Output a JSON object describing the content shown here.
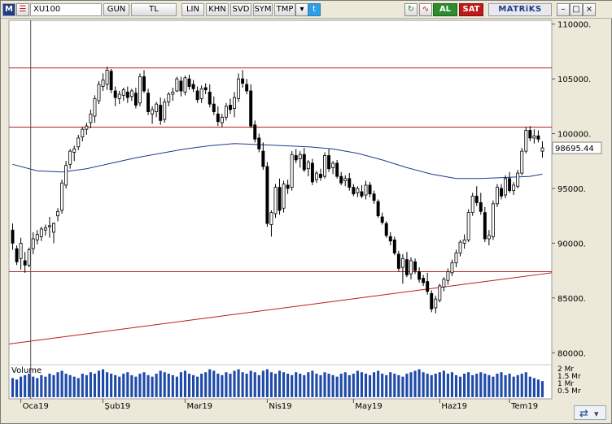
{
  "toolbar": {
    "menu_label": "M",
    "symbol": "XU100",
    "period": "GUN",
    "currency": "TL",
    "scale": "LIN",
    "khn": "KHN",
    "svd": "SVD",
    "sym_btn": "SYM",
    "tmp_btn": "TMP",
    "buy": "AL",
    "sell": "SAT",
    "logo": "MATRiKS"
  },
  "colors": {
    "accent": "#1f3c88",
    "buy": "#2e8b2e",
    "sell": "#c0191b",
    "support_line": "#c0191b",
    "moving_average": "#1f3a8a",
    "cursor": "#555555"
  },
  "icons": [
    "list-icon",
    "twitter-icon",
    "refresh-icon",
    "wave-icon",
    "minimize-icon",
    "maximize-icon",
    "close-icon",
    "dropdown-arrow-icon",
    "sync-icon"
  ],
  "chart_data": {
    "type": "candlestick",
    "price_axis": {
      "ticks": [
        110000,
        105000,
        100000,
        95000,
        90000,
        85000,
        80000
      ],
      "tick_labels": [
        "110000.",
        "105000.",
        "100000.",
        "95000.",
        "90000.",
        "85000.",
        "80000."
      ],
      "ylim": [
        79500,
        110200
      ]
    },
    "last_price_label": "98695.44",
    "horizontal_lines": [
      106000,
      100600,
      87400
    ],
    "trend_line": {
      "from": [
        0,
        80800
      ],
      "to": [
        129,
        87300
      ]
    },
    "cursor_index": 4,
    "volume": {
      "label": "Volume",
      "ticks_labels": [
        "2 Mr",
        "1.5 Mr",
        "1 Mr",
        "0.5 Mr"
      ],
      "ticks": [
        2,
        1.5,
        1,
        0.5
      ],
      "ylim": [
        0,
        2.1
      ]
    },
    "x_tick_labels": [
      {
        "label": "Oca19",
        "index": 2
      },
      {
        "label": "Şub19",
        "index": 22
      },
      {
        "label": "Mar19",
        "index": 42
      },
      {
        "label": "Nis19",
        "index": 62
      },
      {
        "label": "May19",
        "index": 83
      },
      {
        "label": "Haz19",
        "index": 104
      },
      {
        "label": "Tem19",
        "index": 121
      }
    ],
    "ohlc": [
      [
        91200,
        91800,
        89400,
        90000
      ],
      [
        89500,
        89800,
        88000,
        88300
      ],
      [
        88600,
        90500,
        87600,
        90000
      ],
      [
        88400,
        89200,
        87300,
        88000
      ],
      [
        88000,
        89600,
        87800,
        89400
      ],
      [
        89500,
        91000,
        89000,
        90400
      ],
      [
        90300,
        91200,
        89900,
        90800
      ],
      [
        90600,
        91500,
        90200,
        91300
      ],
      [
        91200,
        91700,
        90700,
        91400
      ],
      [
        91500,
        92400,
        90500,
        91600
      ],
      [
        91000,
        91900,
        90000,
        91800
      ],
      [
        92500,
        93200,
        92000,
        92900
      ],
      [
        93000,
        95800,
        92700,
        95500
      ],
      [
        95300,
        97500,
        95000,
        97100
      ],
      [
        97200,
        98600,
        96800,
        98400
      ],
      [
        98300,
        98900,
        97500,
        98600
      ],
      [
        98800,
        99900,
        98500,
        99600
      ],
      [
        99700,
        100600,
        99300,
        100400
      ],
      [
        100400,
        101000,
        99900,
        100700
      ],
      [
        101000,
        102200,
        100500,
        101800
      ],
      [
        101600,
        103500,
        101000,
        103200
      ],
      [
        103000,
        104800,
        102700,
        104500
      ],
      [
        104300,
        105500,
        103900,
        104900
      ],
      [
        104500,
        106100,
        104000,
        105800
      ],
      [
        105700,
        105900,
        103700,
        104000
      ],
      [
        103900,
        104300,
        102500,
        103300
      ],
      [
        103200,
        103900,
        102700,
        103600
      ],
      [
        103500,
        104200,
        103000,
        104000
      ],
      [
        103800,
        104300,
        102800,
        103300
      ],
      [
        103400,
        104100,
        103000,
        103900
      ],
      [
        103700,
        104200,
        102300,
        102600
      ],
      [
        102800,
        105500,
        102500,
        105200
      ],
      [
        105200,
        105800,
        103700,
        103900
      ],
      [
        103700,
        104100,
        101700,
        102000
      ],
      [
        101800,
        102500,
        100900,
        102200
      ],
      [
        102000,
        102900,
        101500,
        102700
      ],
      [
        102600,
        103300,
        100800,
        101200
      ],
      [
        101300,
        103200,
        101000,
        102900
      ],
      [
        102900,
        103800,
        102500,
        103600
      ],
      [
        103600,
        104200,
        103000,
        103800
      ],
      [
        103900,
        105200,
        103800,
        105000
      ],
      [
        104800,
        105200,
        103400,
        103900
      ],
      [
        103800,
        105300,
        103500,
        105100
      ],
      [
        105000,
        105400,
        104000,
        104300
      ],
      [
        104500,
        104900,
        103800,
        104100
      ],
      [
        103900,
        104300,
        102800,
        103100
      ],
      [
        103200,
        104400,
        102800,
        104100
      ],
      [
        104200,
        104600,
        103600,
        104000
      ],
      [
        103800,
        104500,
        102400,
        102700
      ],
      [
        102700,
        103400,
        101700,
        102000
      ],
      [
        101800,
        102500,
        100700,
        101100
      ],
      [
        101000,
        101800,
        100600,
        101500
      ],
      [
        101500,
        102800,
        101200,
        102500
      ],
      [
        102600,
        103200,
        101800,
        102200
      ],
      [
        102300,
        103800,
        101500,
        103300
      ],
      [
        103200,
        105500,
        102900,
        105000
      ],
      [
        105000,
        105800,
        104200,
        104600
      ],
      [
        104500,
        105000,
        103600,
        103900
      ],
      [
        103900,
        104500,
        100500,
        100700
      ],
      [
        100800,
        101200,
        99200,
        99500
      ],
      [
        99600,
        100000,
        98300,
        98600
      ],
      [
        98400,
        99200,
        96700,
        97000
      ],
      [
        97000,
        97400,
        91500,
        91800
      ],
      [
        91700,
        93000,
        90600,
        92800
      ],
      [
        92700,
        95400,
        92300,
        95100
      ],
      [
        95100,
        95900,
        92600,
        93000
      ],
      [
        93200,
        95700,
        92800,
        95400
      ],
      [
        95300,
        95800,
        94500,
        95000
      ],
      [
        95100,
        98400,
        94800,
        98100
      ],
      [
        98000,
        98600,
        97300,
        97600
      ],
      [
        97700,
        98400,
        96900,
        98100
      ],
      [
        98100,
        98700,
        96500,
        96700
      ],
      [
        96800,
        97600,
        96100,
        97400
      ],
      [
        97300,
        97700,
        95300,
        95600
      ],
      [
        95800,
        96600,
        95500,
        96400
      ],
      [
        96300,
        96800,
        95700,
        96000
      ],
      [
        96100,
        98300,
        95900,
        98000
      ],
      [
        98000,
        98600,
        96500,
        96800
      ],
      [
        96900,
        97500,
        96300,
        97300
      ],
      [
        97300,
        97600,
        95900,
        96100
      ],
      [
        96100,
        96500,
        95300,
        95500
      ],
      [
        95700,
        96200,
        95200,
        95900
      ],
      [
        95900,
        96400,
        94800,
        95100
      ],
      [
        95100,
        95400,
        94300,
        94500
      ],
      [
        94600,
        95200,
        94200,
        95000
      ],
      [
        94700,
        95300,
        94100,
        94300
      ],
      [
        94400,
        95700,
        94000,
        95300
      ],
      [
        95300,
        95600,
        94200,
        94500
      ],
      [
        94500,
        94800,
        93600,
        93900
      ],
      [
        93800,
        94000,
        92300,
        92500
      ],
      [
        92400,
        92800,
        91700,
        91900
      ],
      [
        91800,
        92000,
        90500,
        90700
      ],
      [
        90600,
        91000,
        89800,
        90200
      ],
      [
        90300,
        90600,
        88900,
        89100
      ],
      [
        89000,
        89300,
        87400,
        87700
      ],
      [
        87800,
        89000,
        86300,
        88600
      ],
      [
        88500,
        89200,
        86900,
        87100
      ],
      [
        87200,
        88700,
        86700,
        88400
      ],
      [
        88300,
        88600,
        87200,
        87500
      ],
      [
        87400,
        87800,
        86400,
        86700
      ],
      [
        86800,
        87100,
        86100,
        86400
      ],
      [
        86500,
        87300,
        85300,
        85600
      ],
      [
        85400,
        85700,
        83700,
        84000
      ],
      [
        84100,
        85200,
        83600,
        84900
      ],
      [
        84800,
        86300,
        84600,
        86100
      ],
      [
        86000,
        86900,
        85600,
        86700
      ],
      [
        86600,
        87700,
        86200,
        87400
      ],
      [
        87300,
        88500,
        87000,
        88200
      ],
      [
        88200,
        89400,
        87800,
        89100
      ],
      [
        89100,
        90300,
        88800,
        90100
      ],
      [
        90000,
        90800,
        89500,
        90300
      ],
      [
        90300,
        93100,
        90100,
        92800
      ],
      [
        92800,
        94600,
        92500,
        94300
      ],
      [
        94300,
        95200,
        93400,
        93700
      ],
      [
        93700,
        94600,
        92600,
        92900
      ],
      [
        92800,
        93300,
        90100,
        90400
      ],
      [
        90400,
        91200,
        89800,
        90700
      ],
      [
        90600,
        93900,
        90300,
        93600
      ],
      [
        93600,
        95400,
        93300,
        95100
      ],
      [
        95000,
        95400,
        94000,
        94300
      ],
      [
        94400,
        96200,
        94100,
        95900
      ],
      [
        95900,
        96500,
        94600,
        94800
      ],
      [
        94800,
        95600,
        94400,
        95300
      ],
      [
        95200,
        96700,
        95000,
        96400
      ],
      [
        96400,
        98700,
        96200,
        98400
      ],
      [
        98400,
        100600,
        98200,
        100300
      ],
      [
        100300,
        100700,
        99300,
        99600
      ],
      [
        99600,
        100400,
        99100,
        99800
      ],
      [
        99800,
        100300,
        99200,
        99500
      ],
      [
        98400,
        99300,
        97800,
        98700
      ]
    ],
    "moving_average": [
      [
        0,
        97200
      ],
      [
        6,
        96600
      ],
      [
        12,
        96500
      ],
      [
        18,
        96800
      ],
      [
        24,
        97300
      ],
      [
        30,
        97800
      ],
      [
        36,
        98200
      ],
      [
        42,
        98600
      ],
      [
        48,
        98900
      ],
      [
        54,
        99100
      ],
      [
        60,
        99000
      ],
      [
        66,
        98900
      ],
      [
        72,
        98800
      ],
      [
        78,
        98600
      ],
      [
        84,
        98200
      ],
      [
        90,
        97600
      ],
      [
        96,
        96900
      ],
      [
        102,
        96300
      ],
      [
        108,
        95900
      ],
      [
        114,
        95900
      ],
      [
        120,
        96000
      ],
      [
        126,
        96100
      ],
      [
        129,
        96300
      ]
    ],
    "volumes": [
      1.3,
      1.2,
      1.4,
      1.5,
      1.6,
      1.4,
      1.3,
      1.5,
      1.4,
      1.6,
      1.5,
      1.7,
      1.8,
      1.6,
      1.5,
      1.4,
      1.3,
      1.6,
      1.5,
      1.7,
      1.6,
      1.8,
      1.9,
      1.7,
      1.6,
      1.5,
      1.4,
      1.6,
      1.7,
      1.5,
      1.4,
      1.6,
      1.7,
      1.5,
      1.4,
      1.6,
      1.8,
      1.7,
      1.6,
      1.5,
      1.4,
      1.7,
      1.8,
      1.6,
      1.5,
      1.4,
      1.6,
      1.7,
      1.9,
      1.8,
      1.6,
      1.5,
      1.7,
      1.6,
      1.8,
      1.9,
      1.7,
      1.6,
      1.8,
      1.7,
      1.5,
      1.8,
      1.9,
      1.7,
      1.6,
      1.8,
      1.7,
      1.6,
      1.5,
      1.7,
      1.6,
      1.5,
      1.7,
      1.8,
      1.6,
      1.5,
      1.7,
      1.6,
      1.5,
      1.4,
      1.6,
      1.7,
      1.5,
      1.6,
      1.8,
      1.7,
      1.6,
      1.5,
      1.7,
      1.8,
      1.6,
      1.5,
      1.7,
      1.6,
      1.5,
      1.4,
      1.6,
      1.7,
      1.8,
      1.9,
      1.7,
      1.6,
      1.5,
      1.6,
      1.7,
      1.8,
      1.6,
      1.7,
      1.5,
      1.4,
      1.6,
      1.7,
      1.5,
      1.6,
      1.7,
      1.6,
      1.5,
      1.4,
      1.6,
      1.7,
      1.5,
      1.6,
      1.4,
      1.5,
      1.6,
      1.7,
      1.4,
      1.3,
      1.2,
      1.1
    ]
  }
}
